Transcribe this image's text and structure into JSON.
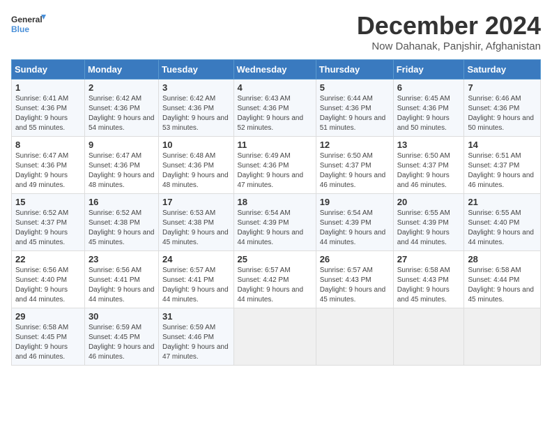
{
  "logo": {
    "text_general": "General",
    "text_blue": "Blue"
  },
  "header": {
    "title": "December 2024",
    "subtitle": "Now Dahanak, Panjshir, Afghanistan"
  },
  "weekdays": [
    "Sunday",
    "Monday",
    "Tuesday",
    "Wednesday",
    "Thursday",
    "Friday",
    "Saturday"
  ],
  "weeks": [
    [
      {
        "day": "1",
        "sunrise": "Sunrise: 6:41 AM",
        "sunset": "Sunset: 4:36 PM",
        "daylight": "Daylight: 9 hours and 55 minutes."
      },
      {
        "day": "2",
        "sunrise": "Sunrise: 6:42 AM",
        "sunset": "Sunset: 4:36 PM",
        "daylight": "Daylight: 9 hours and 54 minutes."
      },
      {
        "day": "3",
        "sunrise": "Sunrise: 6:42 AM",
        "sunset": "Sunset: 4:36 PM",
        "daylight": "Daylight: 9 hours and 53 minutes."
      },
      {
        "day": "4",
        "sunrise": "Sunrise: 6:43 AM",
        "sunset": "Sunset: 4:36 PM",
        "daylight": "Daylight: 9 hours and 52 minutes."
      },
      {
        "day": "5",
        "sunrise": "Sunrise: 6:44 AM",
        "sunset": "Sunset: 4:36 PM",
        "daylight": "Daylight: 9 hours and 51 minutes."
      },
      {
        "day": "6",
        "sunrise": "Sunrise: 6:45 AM",
        "sunset": "Sunset: 4:36 PM",
        "daylight": "Daylight: 9 hours and 50 minutes."
      },
      {
        "day": "7",
        "sunrise": "Sunrise: 6:46 AM",
        "sunset": "Sunset: 4:36 PM",
        "daylight": "Daylight: 9 hours and 50 minutes."
      }
    ],
    [
      {
        "day": "8",
        "sunrise": "Sunrise: 6:47 AM",
        "sunset": "Sunset: 4:36 PM",
        "daylight": "Daylight: 9 hours and 49 minutes."
      },
      {
        "day": "9",
        "sunrise": "Sunrise: 6:47 AM",
        "sunset": "Sunset: 4:36 PM",
        "daylight": "Daylight: 9 hours and 48 minutes."
      },
      {
        "day": "10",
        "sunrise": "Sunrise: 6:48 AM",
        "sunset": "Sunset: 4:36 PM",
        "daylight": "Daylight: 9 hours and 48 minutes."
      },
      {
        "day": "11",
        "sunrise": "Sunrise: 6:49 AM",
        "sunset": "Sunset: 4:36 PM",
        "daylight": "Daylight: 9 hours and 47 minutes."
      },
      {
        "day": "12",
        "sunrise": "Sunrise: 6:50 AM",
        "sunset": "Sunset: 4:37 PM",
        "daylight": "Daylight: 9 hours and 46 minutes."
      },
      {
        "day": "13",
        "sunrise": "Sunrise: 6:50 AM",
        "sunset": "Sunset: 4:37 PM",
        "daylight": "Daylight: 9 hours and 46 minutes."
      },
      {
        "day": "14",
        "sunrise": "Sunrise: 6:51 AM",
        "sunset": "Sunset: 4:37 PM",
        "daylight": "Daylight: 9 hours and 46 minutes."
      }
    ],
    [
      {
        "day": "15",
        "sunrise": "Sunrise: 6:52 AM",
        "sunset": "Sunset: 4:37 PM",
        "daylight": "Daylight: 9 hours and 45 minutes."
      },
      {
        "day": "16",
        "sunrise": "Sunrise: 6:52 AM",
        "sunset": "Sunset: 4:38 PM",
        "daylight": "Daylight: 9 hours and 45 minutes."
      },
      {
        "day": "17",
        "sunrise": "Sunrise: 6:53 AM",
        "sunset": "Sunset: 4:38 PM",
        "daylight": "Daylight: 9 hours and 45 minutes."
      },
      {
        "day": "18",
        "sunrise": "Sunrise: 6:54 AM",
        "sunset": "Sunset: 4:39 PM",
        "daylight": "Daylight: 9 hours and 44 minutes."
      },
      {
        "day": "19",
        "sunrise": "Sunrise: 6:54 AM",
        "sunset": "Sunset: 4:39 PM",
        "daylight": "Daylight: 9 hours and 44 minutes."
      },
      {
        "day": "20",
        "sunrise": "Sunrise: 6:55 AM",
        "sunset": "Sunset: 4:39 PM",
        "daylight": "Daylight: 9 hours and 44 minutes."
      },
      {
        "day": "21",
        "sunrise": "Sunrise: 6:55 AM",
        "sunset": "Sunset: 4:40 PM",
        "daylight": "Daylight: 9 hours and 44 minutes."
      }
    ],
    [
      {
        "day": "22",
        "sunrise": "Sunrise: 6:56 AM",
        "sunset": "Sunset: 4:40 PM",
        "daylight": "Daylight: 9 hours and 44 minutes."
      },
      {
        "day": "23",
        "sunrise": "Sunrise: 6:56 AM",
        "sunset": "Sunset: 4:41 PM",
        "daylight": "Daylight: 9 hours and 44 minutes."
      },
      {
        "day": "24",
        "sunrise": "Sunrise: 6:57 AM",
        "sunset": "Sunset: 4:41 PM",
        "daylight": "Daylight: 9 hours and 44 minutes."
      },
      {
        "day": "25",
        "sunrise": "Sunrise: 6:57 AM",
        "sunset": "Sunset: 4:42 PM",
        "daylight": "Daylight: 9 hours and 44 minutes."
      },
      {
        "day": "26",
        "sunrise": "Sunrise: 6:57 AM",
        "sunset": "Sunset: 4:43 PM",
        "daylight": "Daylight: 9 hours and 45 minutes."
      },
      {
        "day": "27",
        "sunrise": "Sunrise: 6:58 AM",
        "sunset": "Sunset: 4:43 PM",
        "daylight": "Daylight: 9 hours and 45 minutes."
      },
      {
        "day": "28",
        "sunrise": "Sunrise: 6:58 AM",
        "sunset": "Sunset: 4:44 PM",
        "daylight": "Daylight: 9 hours and 45 minutes."
      }
    ],
    [
      {
        "day": "29",
        "sunrise": "Sunrise: 6:58 AM",
        "sunset": "Sunset: 4:45 PM",
        "daylight": "Daylight: 9 hours and 46 minutes."
      },
      {
        "day": "30",
        "sunrise": "Sunrise: 6:59 AM",
        "sunset": "Sunset: 4:45 PM",
        "daylight": "Daylight: 9 hours and 46 minutes."
      },
      {
        "day": "31",
        "sunrise": "Sunrise: 6:59 AM",
        "sunset": "Sunset: 4:46 PM",
        "daylight": "Daylight: 9 hours and 47 minutes."
      },
      null,
      null,
      null,
      null
    ]
  ]
}
